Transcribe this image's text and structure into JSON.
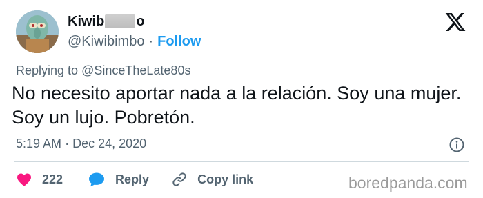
{
  "author": {
    "name_start": "Kiwib",
    "name_end": "o",
    "handle": "@Kiwibimbo",
    "separator": "·",
    "follow_label": "Follow"
  },
  "reply": {
    "prefix": "Replying to",
    "mention": "@SinceTheLate80s"
  },
  "tweet": {
    "line1": "No necesito aportar nada a la relación. Soy una mujer.",
    "line2": "Soy un lujo. Pobretón."
  },
  "meta": {
    "time": "5:19 AM",
    "separator": "·",
    "date": "Dec 24, 2020"
  },
  "actions": {
    "likes": "222",
    "reply_label": "Reply",
    "copy_link_label": "Copy link"
  },
  "watermark": "boredpanda.com",
  "icons": {
    "logo": "x-logo-icon",
    "info": "info-icon",
    "like": "heart-icon",
    "reply": "speech-bubble-icon",
    "copy": "link-icon"
  },
  "colors": {
    "follow": "#1d9bf0",
    "heart": "#f91880",
    "reply": "#1d9bf0",
    "muted": "#536471",
    "text": "#0f1419"
  }
}
